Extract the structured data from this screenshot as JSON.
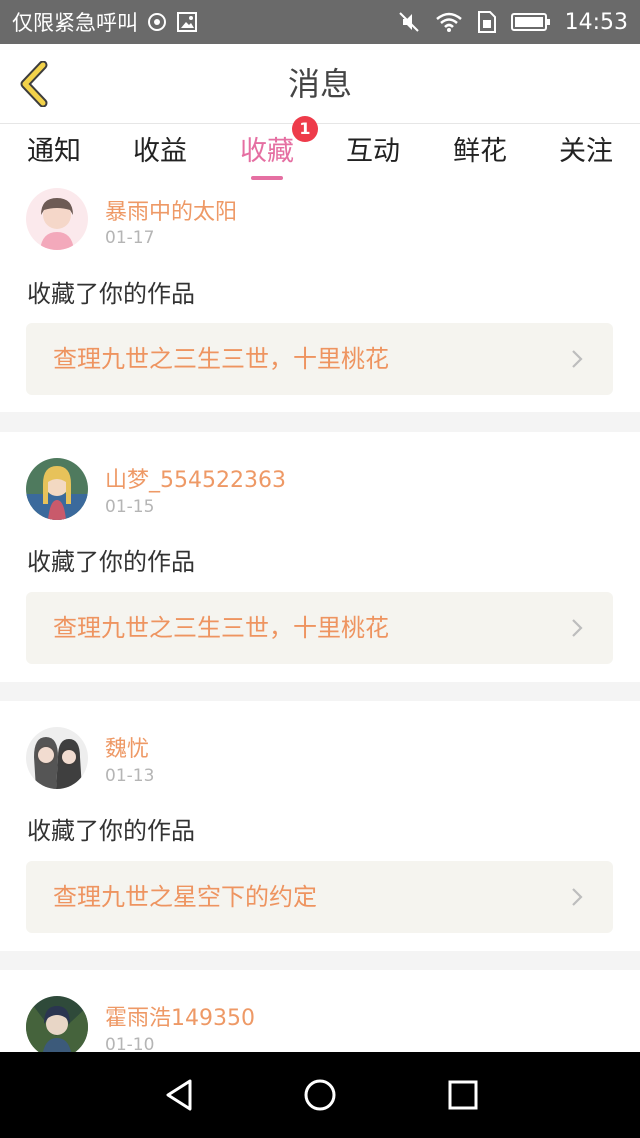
{
  "status_bar": {
    "carrier_text": "仅限紧急呼叫",
    "time": "14:53",
    "icons": [
      "hotspot-icon",
      "image-icon",
      "mute-icon",
      "wifi-icon",
      "sim-icon",
      "battery-icon"
    ]
  },
  "header": {
    "title": "消息",
    "back_icon": "chevron-left-icon"
  },
  "tabs": [
    {
      "label": "通知"
    },
    {
      "label": "收益"
    },
    {
      "label": "收藏",
      "active": true,
      "badge": "1"
    },
    {
      "label": "互动"
    },
    {
      "label": "鲜花"
    },
    {
      "label": "关注"
    }
  ],
  "messages": [
    {
      "user": "暴雨中的太阳",
      "date": "01-17",
      "action": "收藏了你的作品",
      "work": "查理九世之三生三世，十里桃花"
    },
    {
      "user": "山梦_554522363",
      "date": "01-15",
      "action": "收藏了你的作品",
      "work": "查理九世之三生三世，十里桃花"
    },
    {
      "user": "魏忧",
      "date": "01-13",
      "action": "收藏了你的作品",
      "work": "查理九世之星空下的约定"
    },
    {
      "user": "霍雨浩149350",
      "date": "01-10"
    }
  ],
  "colors": {
    "accent": "#e56fa2",
    "username": "#ee9966",
    "work_title": "#ee9460",
    "badge": "#ee3b4a",
    "status_bar": "#6a6a6a"
  },
  "system_nav": [
    "back-triangle-icon",
    "home-circle-icon",
    "recents-square-icon"
  ]
}
